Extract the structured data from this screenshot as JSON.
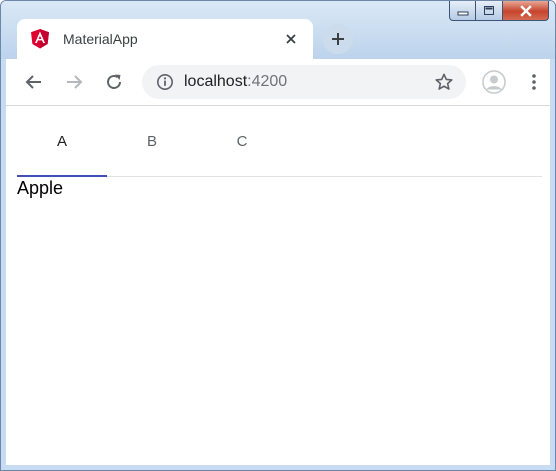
{
  "window": {
    "controls": [
      "minimize",
      "maximize",
      "close"
    ]
  },
  "browser_tab": {
    "title": "MaterialApp",
    "favicon": "angular-logo-icon",
    "accent": "#dd0031"
  },
  "toolbar": {
    "url_host": "localhost",
    "url_port": ":4200"
  },
  "page": {
    "tabs": [
      {
        "label": "A",
        "active": true
      },
      {
        "label": "B",
        "active": false
      },
      {
        "label": "C",
        "active": false
      }
    ],
    "active_content": "Apple",
    "ink_color": "#3f51b5"
  }
}
